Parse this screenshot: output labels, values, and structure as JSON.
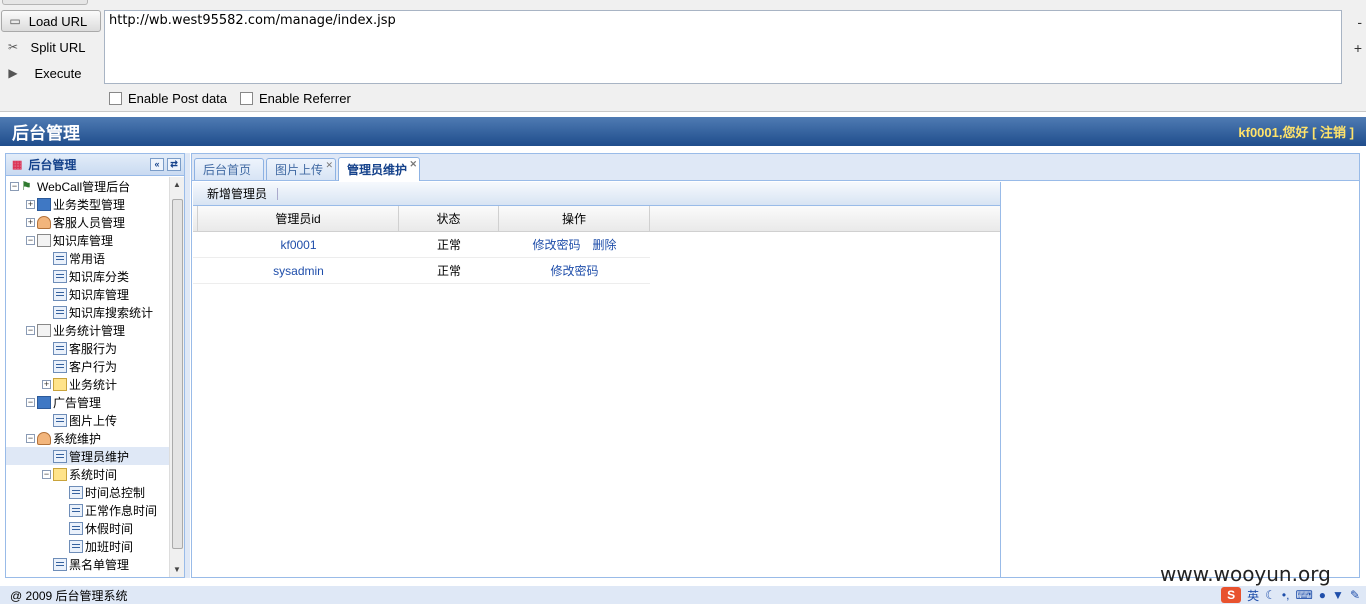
{
  "hackbar": {
    "load_label": "Load URL",
    "split_label": "Split URL",
    "execute_label": "Execute",
    "url": "http://wb.west95582.com/manage/index.jsp",
    "minus": "-",
    "plus": "+",
    "post_label": "Enable Post data",
    "referrer_label": "Enable Referrer"
  },
  "header": {
    "title": "后台管理",
    "greeting": "kf0001,您好",
    "logout": "[ 注销 ]"
  },
  "west": {
    "title": "后台管理",
    "collapse": "«",
    "refresh": "⇄",
    "tree": [
      {
        "label": "WebCall管理后台",
        "indent": 0,
        "exp": "−",
        "icon": "net"
      },
      {
        "label": "业务类型管理",
        "indent": 1,
        "exp": "+",
        "icon": "disk"
      },
      {
        "label": "客服人员管理",
        "indent": 1,
        "exp": "+",
        "icon": "user"
      },
      {
        "label": "知识库管理",
        "indent": 1,
        "exp": "−",
        "icon": "kb"
      },
      {
        "label": "常用语",
        "indent": 2,
        "exp": "",
        "icon": "leaf"
      },
      {
        "label": "知识库分类",
        "indent": 2,
        "exp": "",
        "icon": "leaf"
      },
      {
        "label": "知识库管理",
        "indent": 2,
        "exp": "",
        "icon": "leaf"
      },
      {
        "label": "知识库搜索统计",
        "indent": 2,
        "exp": "",
        "icon": "leaf"
      },
      {
        "label": "业务统计管理",
        "indent": 1,
        "exp": "−",
        "icon": "kb"
      },
      {
        "label": "客服行为",
        "indent": 2,
        "exp": "",
        "icon": "leaf"
      },
      {
        "label": "客户行为",
        "indent": 2,
        "exp": "",
        "icon": "leaf"
      },
      {
        "label": "业务统计",
        "indent": 2,
        "exp": "+",
        "icon": "folder"
      },
      {
        "label": "广告管理",
        "indent": 1,
        "exp": "−",
        "icon": "disk"
      },
      {
        "label": "图片上传",
        "indent": 2,
        "exp": "",
        "icon": "leaf"
      },
      {
        "label": "系统维护",
        "indent": 1,
        "exp": "−",
        "icon": "user"
      },
      {
        "label": "管理员维护",
        "indent": 2,
        "exp": "",
        "icon": "leaf",
        "selected": true
      },
      {
        "label": "系统时间",
        "indent": 2,
        "exp": "−",
        "icon": "folder"
      },
      {
        "label": "时间总控制",
        "indent": 3,
        "exp": "",
        "icon": "leaf"
      },
      {
        "label": "正常作息时间",
        "indent": 3,
        "exp": "",
        "icon": "leaf"
      },
      {
        "label": "休假时间",
        "indent": 3,
        "exp": "",
        "icon": "leaf"
      },
      {
        "label": "加班时间",
        "indent": 3,
        "exp": "",
        "icon": "leaf"
      },
      {
        "label": "黑名单管理",
        "indent": 2,
        "exp": "",
        "icon": "leaf"
      }
    ]
  },
  "tabs": [
    {
      "label": "后台首页",
      "closable": false,
      "active": false
    },
    {
      "label": "图片上传",
      "closable": true,
      "active": false
    },
    {
      "label": "管理员维护",
      "closable": true,
      "active": true
    }
  ],
  "grid": {
    "toolbar_add": "新增管理员",
    "columns": [
      "管理员id",
      "状态",
      "操作"
    ],
    "rows": [
      {
        "id": "kf0001",
        "status": "正常",
        "actions": [
          "修改密码",
          "删除"
        ]
      },
      {
        "id": "sysadmin",
        "status": "正常",
        "actions": [
          "修改密码"
        ]
      }
    ]
  },
  "footer": {
    "copyright": "@ 2009 后台管理系统"
  },
  "watermark": "www.wooyun.org",
  "tray": {
    "ime": "S",
    "lang": "英"
  }
}
